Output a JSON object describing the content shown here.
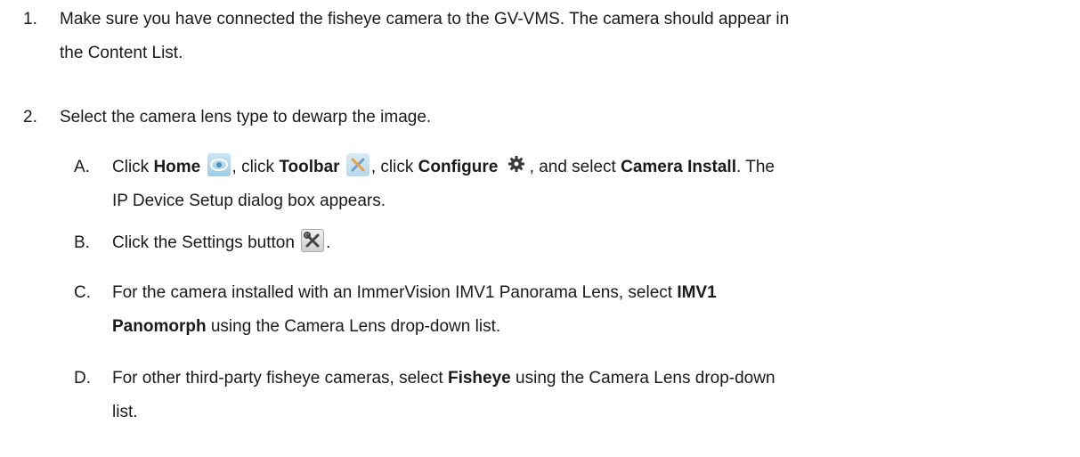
{
  "steps": [
    {
      "num": "1.",
      "line1": "Make sure you have connected the fisheye camera to the GV-VMS. The camera should appear in",
      "line2": "the Content List."
    },
    {
      "num": "2.",
      "text": "Select the camera lens type to dewarp the image.",
      "substeps": {
        "A": {
          "num": "A.",
          "t1": "Click ",
          "b1": "Home",
          "t2": ", click ",
          "b2": "Toolbar",
          "t3": ", click ",
          "b3": "Configure",
          "t4": ", and select ",
          "b4": "Camera Install",
          "t5": ". The",
          "line2": "IP Device Setup dialog box appears.",
          "icons": [
            "home-icon",
            "toolbar-icon",
            "gear-icon"
          ]
        },
        "B": {
          "num": "B.",
          "t1": "Click the Settings button",
          "t2": ".",
          "icon": "settings-icon"
        },
        "C": {
          "num": "C.",
          "line1": "For the camera installed with an ImmerVision IMV1 Panorama Lens, select ",
          "b1": "IMV1",
          "b2": "Panomorph",
          "line2": " using the Camera Lens drop-down list."
        },
        "D": {
          "num": "D.",
          "t1": "For other third-party fisheye cameras, select ",
          "b1": "Fisheye",
          "t2": " using the Camera Lens drop-down",
          "line2": "list."
        }
      }
    }
  ]
}
